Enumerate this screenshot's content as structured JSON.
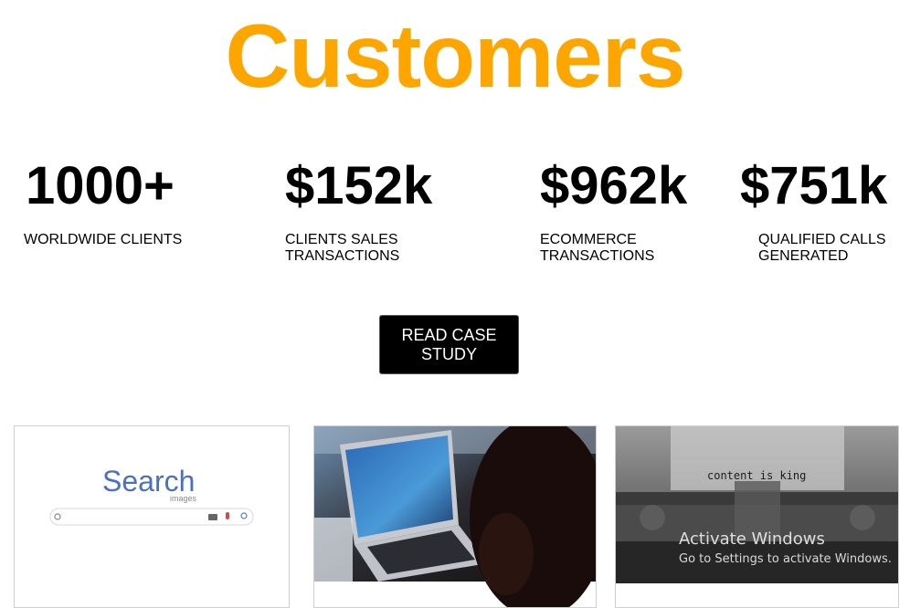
{
  "page": {
    "title": "Customers"
  },
  "stats": [
    {
      "value": "1000+",
      "label_lines": [
        "WORLDWIDE CLIENTS"
      ]
    },
    {
      "value": "$152k",
      "label_lines": [
        "CLIENTS SALES",
        "TRANSACTIONS"
      ]
    },
    {
      "value": "$962k",
      "label_lines": [
        "ECOMMERCE",
        "TRANSACTIONS"
      ]
    },
    {
      "value": "$751k",
      "label_lines": [
        "QUALIFIED CALLS",
        "GENERATED"
      ]
    }
  ],
  "cta": {
    "label_lines": [
      "READ CASE",
      "STUDY"
    ]
  },
  "cards": [
    {
      "image": "search-images-screenshot",
      "logo_text": "Search",
      "logo_sub": "images"
    },
    {
      "image": "laptop-workspace-photo"
    },
    {
      "image": "typewriter-photo",
      "typed_text": "content is king"
    }
  ],
  "watermark": {
    "line1": "Activate Windows",
    "line2": "Go to Settings to activate Windows."
  },
  "colors": {
    "title": "#ffa500",
    "button_bg": "#000000",
    "button_text": "#ffffff"
  }
}
